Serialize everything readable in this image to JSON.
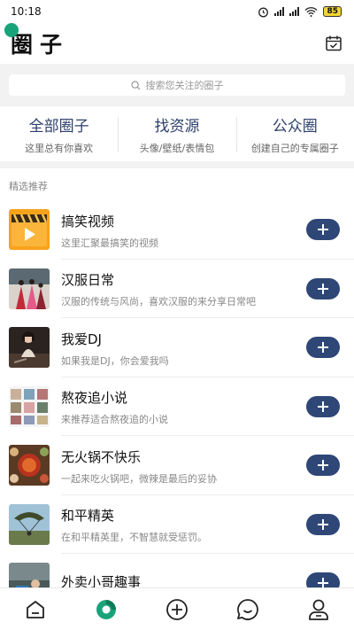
{
  "status_bar": {
    "time": "10:18",
    "battery": "85"
  },
  "header": {
    "title": "圈子",
    "calendar_icon": "calendar-check-icon"
  },
  "search": {
    "placeholder": "搜索您关注的圈子"
  },
  "categories": [
    {
      "title": "全部圈子",
      "subtitle": "这里总有你喜欢"
    },
    {
      "title": "找资源",
      "subtitle": "头像/壁纸/表情包"
    },
    {
      "title": "公众圈",
      "subtitle": "创建自己的专属圈子"
    }
  ],
  "section_label": "精选推荐",
  "items": [
    {
      "title": "搞笑视频",
      "desc": "这里汇聚最搞笑的视频",
      "thumb": "video-clapper"
    },
    {
      "title": "汉服日常",
      "desc": "汉服的传统与风尚，喜欢汉服的来分享日常吧",
      "thumb": "hanfu-photo"
    },
    {
      "title": "我爱DJ",
      "desc": "如果我是DJ，你会爱我吗",
      "thumb": "dj-photo"
    },
    {
      "title": "熬夜追小说",
      "desc": "来推荐适合熬夜追的小说",
      "thumb": "novel-collage"
    },
    {
      "title": "无火锅不快乐",
      "desc": "一起来吃火锅吧，微辣是最后的妥协",
      "thumb": "hotpot-photo"
    },
    {
      "title": "和平精英",
      "desc": "在和平精英里，不智慧就受惩罚。",
      "thumb": "game-photo"
    },
    {
      "title": "外卖小哥趣事",
      "desc": "",
      "thumb": "delivery-photo"
    }
  ],
  "bottom_nav": [
    "home-icon",
    "circle-icon",
    "add-circle-icon",
    "message-icon",
    "profile-icon"
  ],
  "colors": {
    "accent": "#2f4777",
    "green": "#19a37a",
    "category_text": "#2d3f6a"
  }
}
